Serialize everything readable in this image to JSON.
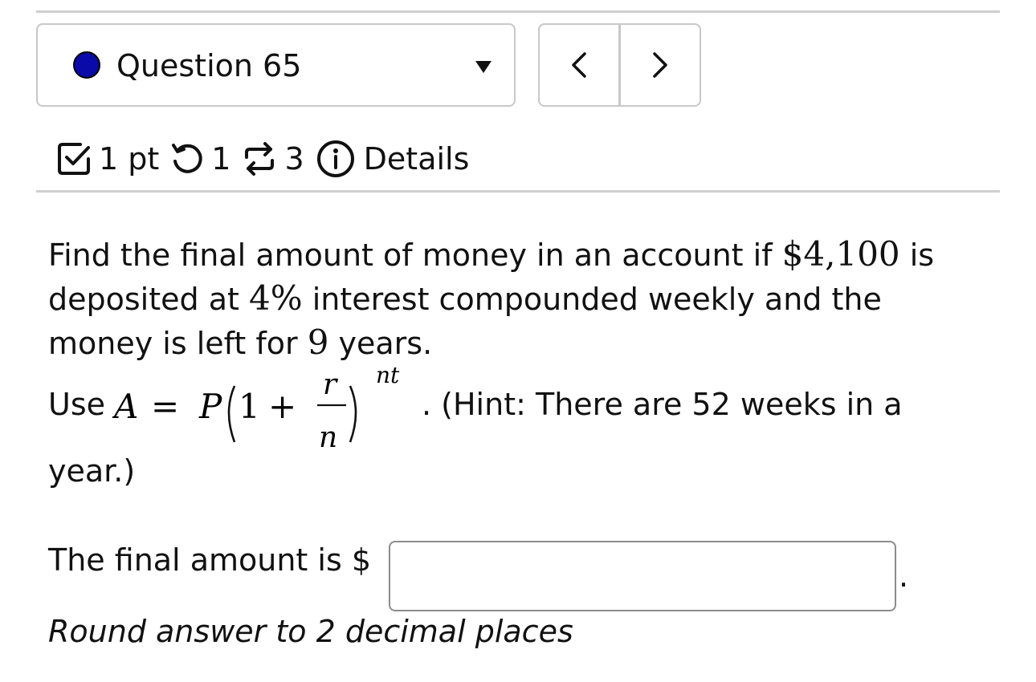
{
  "header": {
    "question_label": "Question 65",
    "status_dot_color": "#0a0aa8",
    "prev_label": "<",
    "next_label": ">"
  },
  "meta": {
    "points": "1 pt",
    "retries": "1",
    "attempts": "3",
    "details_label": "Details"
  },
  "problem": {
    "line1_prefix": "Find the final amount of money in an account if ",
    "principal": "$4,100",
    "line1_suffix": " is deposited at ",
    "rate": "4%",
    "line2_suffix": " interest compounded weekly and the money is left for ",
    "years": "9",
    "line3_suffix": " years.",
    "use_label": "Use",
    "formula": {
      "lhs": "A",
      "eq": "=",
      "P": "P",
      "one": "1",
      "plus": "+",
      "numerator": "r",
      "denominator": "n",
      "exponent": "nt"
    },
    "hint": ". (Hint: There are 52 weeks in a",
    "hint_end": "year.)"
  },
  "answer": {
    "prompt": "The final amount is $",
    "value": "",
    "placeholder": "",
    "trailing_period": ".",
    "note": "Round answer to 2 decimal places"
  }
}
